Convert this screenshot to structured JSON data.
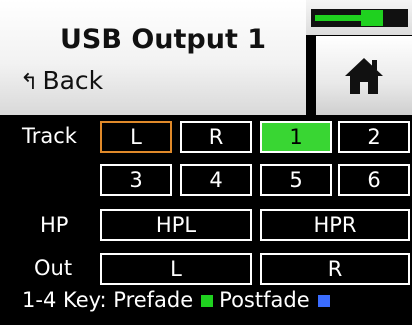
{
  "header": {
    "title": "USB Output 1",
    "back_label": "Back",
    "back_arrow": "↰"
  },
  "meter": {
    "level": 0.56
  },
  "rows": {
    "track": {
      "label": "Track",
      "buttons": [
        "L",
        "R",
        "1",
        "2"
      ],
      "buttons2": [
        "3",
        "4",
        "5",
        "6"
      ]
    },
    "hp": {
      "label": "HP",
      "buttons": [
        "HPL",
        "HPR"
      ]
    },
    "out": {
      "label": "Out",
      "buttons": [
        "L",
        "R"
      ]
    }
  },
  "key": {
    "text": "1-4 Key: Prefade",
    "postfade": "Postfade",
    "prefade_color": "#1fd11f",
    "postfade_color": "#3b6dff"
  },
  "colors": {
    "selected_outline": "#e08a2a",
    "active_fill": "#39d633"
  }
}
